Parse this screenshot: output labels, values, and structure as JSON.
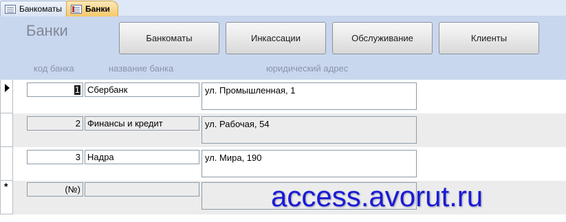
{
  "tabs": [
    {
      "label": "Банкоматы",
      "active": false
    },
    {
      "label": "Банки",
      "active": true
    }
  ],
  "form": {
    "title": "Банки",
    "nav_buttons": [
      "Банкоматы",
      "Инкассации",
      "Обслуживание",
      "Клиенты"
    ],
    "columns": {
      "code": "код банка",
      "name": "название банка",
      "address": "юридический адрес"
    }
  },
  "records": [
    {
      "code": "1",
      "name": "Сбербанк",
      "address": "ул. Промышленная, 1"
    },
    {
      "code": "2",
      "name": "Финансы и кредит",
      "address": "ул. Рабочая, 54"
    },
    {
      "code": "3",
      "name": "Надра",
      "address": "ул. Мира, 190"
    }
  ],
  "new_record": {
    "code": "(№)",
    "name": "",
    "address": "",
    "marker": "*"
  },
  "watermark": "access.avorut.ru",
  "colors": {
    "header_bg": "#c9d7ee",
    "active_tab": "#f6c96b",
    "watermark": "#1a1ad6"
  }
}
